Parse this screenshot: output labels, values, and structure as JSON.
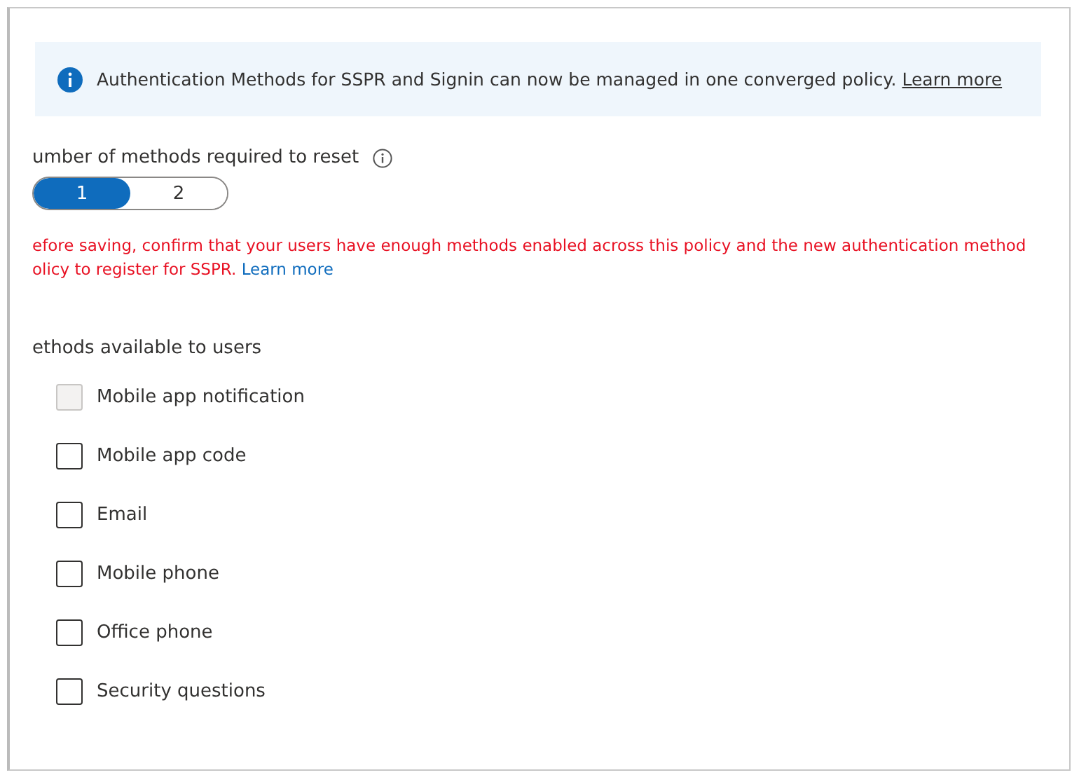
{
  "info_banner": {
    "text": "Authentication Methods for SSPR and Signin can now be managed in one converged policy.",
    "link": "Learn more"
  },
  "methods_required": {
    "label": "umber of methods required to reset",
    "options": [
      {
        "label": "1",
        "selected": true
      },
      {
        "label": "2",
        "selected": false
      }
    ]
  },
  "warning": {
    "text": "efore saving, confirm that your users have enough methods enabled across this policy and the new authentication method",
    "text_2": "olicy to register for SSPR.",
    "link": "Learn more"
  },
  "methods": {
    "label": "ethods available to users",
    "items": [
      {
        "label": "Mobile app notification",
        "checked": false,
        "disabled": true
      },
      {
        "label": "Mobile app code",
        "checked": false,
        "disabled": false
      },
      {
        "label": "Email",
        "checked": false,
        "disabled": false
      },
      {
        "label": "Mobile phone",
        "checked": false,
        "disabled": false
      },
      {
        "label": "Office phone",
        "checked": false,
        "disabled": false
      },
      {
        "label": "Security questions",
        "checked": false,
        "disabled": false
      }
    ]
  }
}
